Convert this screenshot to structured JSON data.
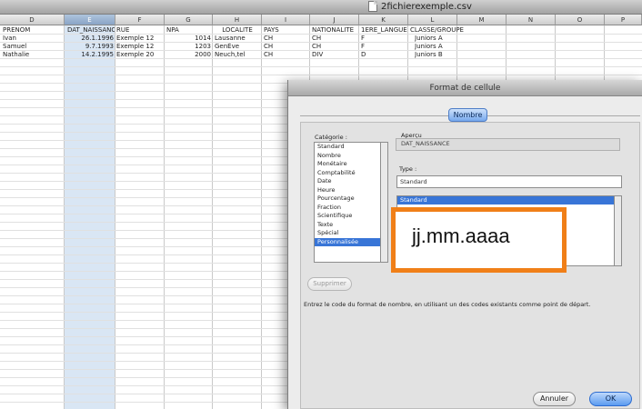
{
  "window": {
    "title": "2fichierexemple.csv",
    "icon": "csv-document-icon"
  },
  "sheet": {
    "columns": [
      "D",
      "E",
      "F",
      "G",
      "H",
      "I",
      "J",
      "K",
      "L",
      "M",
      "N",
      "O",
      "P"
    ],
    "selected_column": "E",
    "header_row": [
      "PRENOM",
      "DAT_NAISSANCE",
      "RUE",
      "NPA",
      "LOCALITE",
      "PAYS",
      "NATIONALITE",
      "1ERE_LANGUE",
      "CLASSE/GROUPE"
    ],
    "rows": [
      [
        "Ivan",
        "26.1.1996",
        "Exemple 12",
        "1014",
        "Lausanne",
        "CH",
        "CH",
        "F",
        "Juniors A"
      ],
      [
        "Samuel",
        "9.7.1993",
        "Exemple 12",
        "1203",
        "GenÈve",
        "CH",
        "CH",
        "F",
        "Juniors A"
      ],
      [
        "Nathalie",
        "14.2.1995",
        "Exemple 20",
        "2000",
        "Neuch,tel",
        "CH",
        "DIV",
        "D",
        "Juniors B"
      ]
    ]
  },
  "dialog": {
    "title": "Format de cellule",
    "tab": "Nombre",
    "category_label": "Catégorie :",
    "categories": [
      "Standard",
      "Nombre",
      "Monétaire",
      "Comptabilité",
      "Date",
      "Heure",
      "Pourcentage",
      "Fraction",
      "Scientifique",
      "Texte",
      "Spécial",
      "Personnalisée"
    ],
    "selected_category": "Personnalisée",
    "preview_label": "Aperçu",
    "preview_value": "DAT_NAISSANCE",
    "type_label": "Type :",
    "type_value": "Standard",
    "type_list": [
      "Standard"
    ],
    "delete_button": "Supprimer",
    "hint": "Entrez le code du format de nombre, en utilisant un des codes existants comme point de départ.",
    "cancel_button": "Annuler",
    "ok_button": "OK"
  },
  "annotation": {
    "text": "jj.mm.aaaa",
    "border_color": "#f07f18"
  }
}
